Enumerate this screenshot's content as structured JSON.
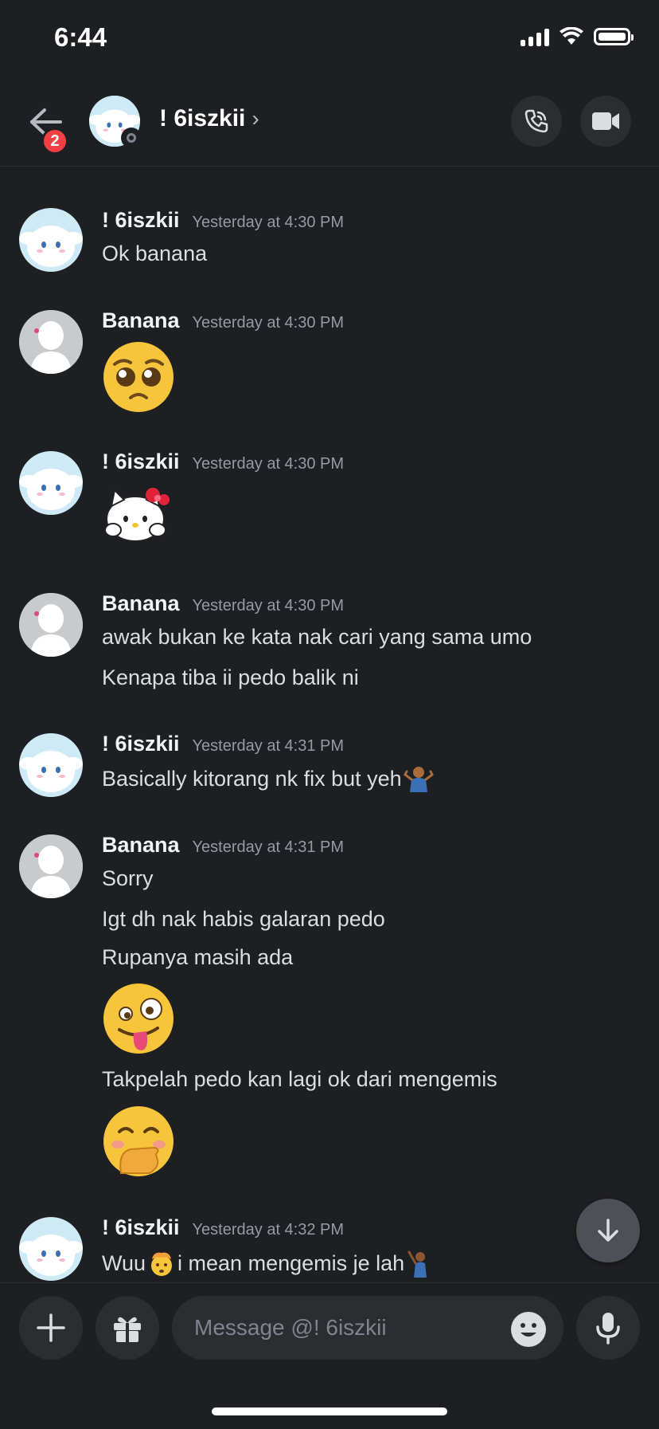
{
  "status_bar": {
    "time": "6:44"
  },
  "header": {
    "title": "! 6iszkii",
    "chevron": "›",
    "unread_badge": "2",
    "icons": [
      "back-arrow-icon",
      "phone-call-icon",
      "video-camera-icon"
    ]
  },
  "messages": [
    {
      "author": "! 6iszkii",
      "timestamp": "Yesterday at 4:30 PM",
      "lines": [
        "Ok banana"
      ]
    },
    {
      "author": "Banana",
      "timestamp": "Yesterday at 4:30 PM",
      "emoji": "pleading-face"
    },
    {
      "author": "! 6iszkii",
      "timestamp": "Yesterday at 4:30 PM",
      "sticker": "hello-kitty"
    },
    {
      "author": "Banana",
      "timestamp": "Yesterday at 4:30 PM",
      "lines": [
        "awak bukan ke kata nak cari yang sama umo",
        "Kenapa tiba ii pedo balik ni"
      ]
    },
    {
      "author": "! 6iszkii",
      "timestamp": "Yesterday at 4:31 PM",
      "lines": [
        "Basically kitorang nk fix but yeh"
      ],
      "trailing_emoji": "person-shrugging"
    },
    {
      "author": "Banana",
      "timestamp": "Yesterday at 4:31 PM",
      "lines": [
        "Sorry",
        "Igt dh nak habis galaran pedo",
        "Rupanya masih ada",
        "Takpelah pedo kan lagi ok dari mengemis"
      ],
      "emojis": [
        "zany-face",
        "face-with-hand-over-mouth"
      ]
    },
    {
      "author": "! 6iszkii",
      "timestamp": "Yesterday at 4:32 PM",
      "lines": [
        "Wuu",
        " i mean mengemis je lah"
      ],
      "emojis": [
        "exploding-head",
        "person-dancing"
      ]
    }
  ],
  "composer": {
    "placeholder": "Message @! 6iszkii"
  }
}
